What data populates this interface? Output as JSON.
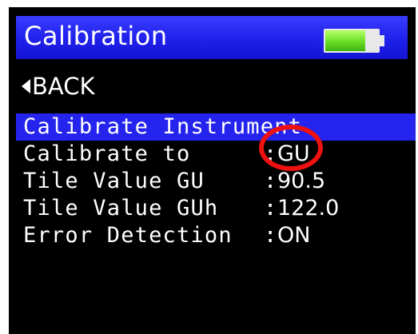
{
  "header": {
    "title": "Calibration",
    "battery_level": 0.75
  },
  "nav": {
    "back_label": "BACK"
  },
  "menu": {
    "items": [
      {
        "label": "Calibrate Instrument",
        "value": "",
        "selected": true
      },
      {
        "label": "Calibrate to",
        "value": "GU"
      },
      {
        "label": "Tile Value GU",
        "value": "90.5"
      },
      {
        "label": "Tile Value GUh",
        "value": "122.0"
      },
      {
        "label": "Error Detection",
        "value": "ON"
      }
    ]
  },
  "colors": {
    "screen_background": "#000000",
    "title_bar": "#1f20ea",
    "selection_highlight": "#2424ee",
    "text": "#ffffff",
    "battery_fill": "#6fe22a",
    "annotation": "#ee1111"
  }
}
